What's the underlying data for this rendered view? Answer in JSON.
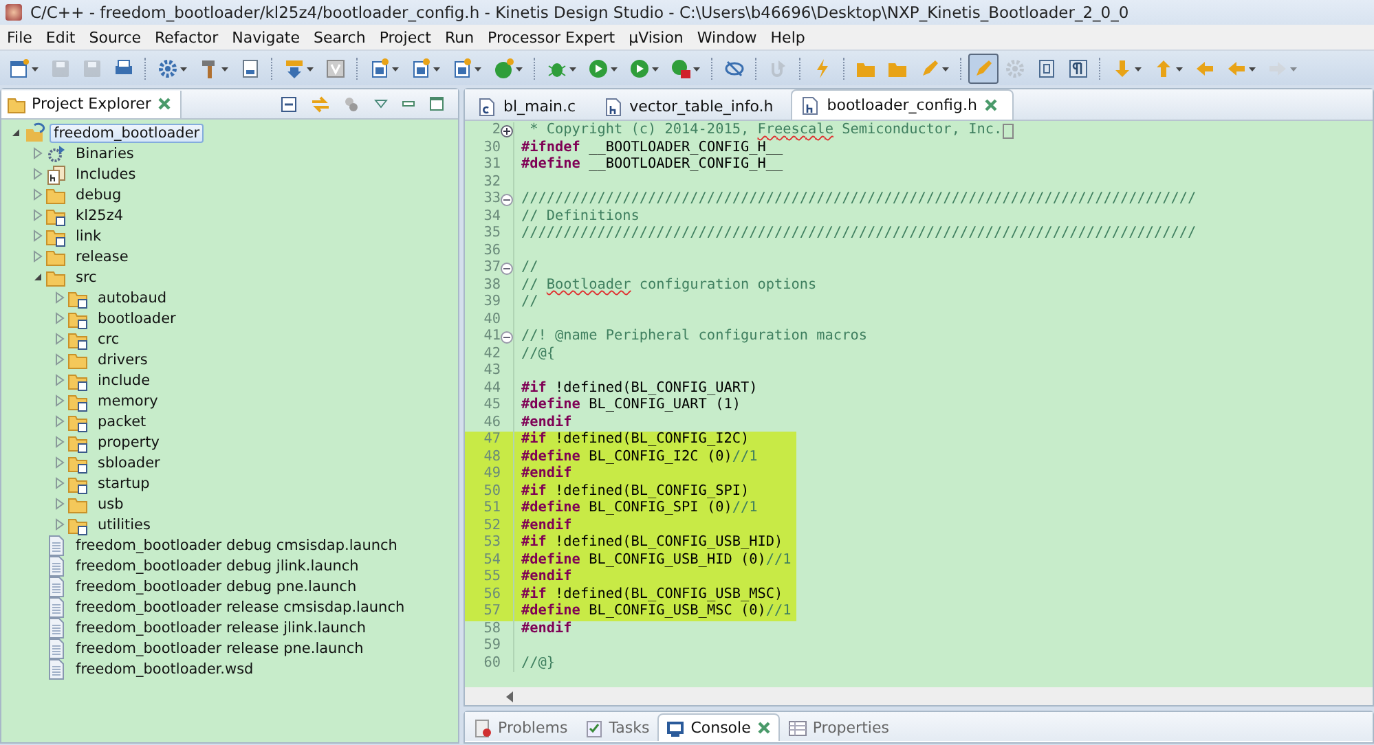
{
  "window": {
    "title": "C/C++ - freedom_bootloader/kl25z4/bootloader_config.h - Kinetis Design Studio - C:\\Users\\b46696\\Desktop\\NXP_Kinetis_Bootloader_2_0_0"
  },
  "menu": [
    "File",
    "Edit",
    "Source",
    "Refactor",
    "Navigate",
    "Search",
    "Project",
    "Run",
    "Processor Expert",
    "µVision",
    "Window",
    "Help"
  ],
  "toolbar": [
    {
      "pressed": false,
      "disabled": false
    },
    {
      "pressed": false,
      "disabled": true
    },
    {
      "pressed": false,
      "disabled": true
    },
    {
      "pressed": false,
      "disabled": false
    },
    {
      "pressed": false,
      "disabled": false
    },
    {
      "pressed": false,
      "disabled": false
    },
    {
      "pressed": false,
      "disabled": false
    },
    {
      "pressed": false,
      "disabled": false
    },
    {
      "pressed": false,
      "disabled": false
    },
    {
      "pressed": false,
      "disabled": false
    },
    {
      "pressed": false,
      "disabled": false
    },
    {
      "pressed": false,
      "disabled": false
    },
    {
      "pressed": false,
      "disabled": false
    },
    {
      "pressed": false,
      "disabled": false
    },
    {
      "pressed": false,
      "disabled": false
    },
    {
      "pressed": false,
      "disabled": false
    },
    {
      "pressed": false,
      "disabled": false
    },
    {
      "pressed": false,
      "disabled": false
    },
    {
      "pressed": false,
      "disabled": true
    },
    {
      "pressed": false,
      "disabled": false
    },
    {
      "pressed": false,
      "disabled": false
    },
    {
      "pressed": false,
      "disabled": false
    },
    {
      "pressed": false,
      "disabled": false
    },
    {
      "pressed": true,
      "disabled": false
    },
    {
      "pressed": false,
      "disabled": true
    },
    {
      "pressed": false,
      "disabled": false
    },
    {
      "pressed": false,
      "disabled": false
    },
    {
      "pressed": false,
      "disabled": false
    },
    {
      "pressed": false,
      "disabled": false
    },
    {
      "pressed": false,
      "disabled": false
    },
    {
      "pressed": false,
      "disabled": false
    },
    {
      "pressed": false,
      "disabled": true
    }
  ],
  "explorer": {
    "title": "Project Explorer",
    "tree": [
      {
        "label": "freedom_bootloader",
        "kind": "project",
        "expanded": true,
        "selected": true,
        "children": [
          {
            "label": "Binaries",
            "kind": "binaries",
            "expanded": false,
            "selected": false
          },
          {
            "label": "Includes",
            "kind": "includes",
            "expanded": false,
            "selected": false
          },
          {
            "label": "debug",
            "kind": "folder",
            "expanded": false,
            "selected": false
          },
          {
            "label": "kl25z4",
            "kind": "linked-folder",
            "expanded": false,
            "selected": false
          },
          {
            "label": "link",
            "kind": "linked-folder",
            "expanded": false,
            "selected": false
          },
          {
            "label": "release",
            "kind": "folder",
            "expanded": false,
            "selected": false
          },
          {
            "label": "src",
            "kind": "folder",
            "expanded": true,
            "selected": false,
            "children": [
              {
                "label": "autobaud",
                "kind": "linked-folder",
                "expanded": false,
                "selected": false
              },
              {
                "label": "bootloader",
                "kind": "linked-folder",
                "expanded": false,
                "selected": false
              },
              {
                "label": "crc",
                "kind": "linked-folder",
                "expanded": false,
                "selected": false
              },
              {
                "label": "drivers",
                "kind": "folder",
                "expanded": false,
                "selected": false
              },
              {
                "label": "include",
                "kind": "linked-folder",
                "expanded": false,
                "selected": false
              },
              {
                "label": "memory",
                "kind": "linked-folder",
                "expanded": false,
                "selected": false
              },
              {
                "label": "packet",
                "kind": "linked-folder",
                "expanded": false,
                "selected": false
              },
              {
                "label": "property",
                "kind": "linked-folder",
                "expanded": false,
                "selected": false
              },
              {
                "label": "sbloader",
                "kind": "linked-folder",
                "expanded": false,
                "selected": false
              },
              {
                "label": "startup",
                "kind": "linked-folder",
                "expanded": false,
                "selected": false
              },
              {
                "label": "usb",
                "kind": "folder",
                "expanded": false,
                "selected": false
              },
              {
                "label": "utilities",
                "kind": "linked-folder",
                "expanded": false,
                "selected": false
              }
            ]
          },
          {
            "label": "freedom_bootloader debug cmsisdap.launch",
            "kind": "file",
            "selected": false
          },
          {
            "label": "freedom_bootloader debug jlink.launch",
            "kind": "file",
            "selected": false
          },
          {
            "label": "freedom_bootloader debug pne.launch",
            "kind": "file",
            "selected": false
          },
          {
            "label": "freedom_bootloader release cmsisdap.launch",
            "kind": "file",
            "selected": false
          },
          {
            "label": "freedom_bootloader release jlink.launch",
            "kind": "file",
            "selected": false
          },
          {
            "label": "freedom_bootloader release pne.launch",
            "kind": "file",
            "selected": false
          },
          {
            "label": "freedom_bootloader.wsd",
            "kind": "file",
            "selected": false
          }
        ]
      }
    ]
  },
  "editor": {
    "tabs": [
      {
        "label": "bl_main.c",
        "kind": "c",
        "selected": false
      },
      {
        "label": "vector_table_info.h",
        "kind": "h",
        "selected": false
      },
      {
        "label": "bootloader_config.h",
        "kind": "h",
        "selected": true
      }
    ],
    "lines": [
      {
        "num": "2",
        "folded": true,
        "highlighted": false,
        "tokens": [
          {
            "kind": "comment",
            "text": " * Copyright (c) 2014-2015, "
          },
          {
            "kind": "comment-misspelled",
            "text": "Freescale"
          },
          {
            "kind": "comment",
            "text": " Semiconductor, Inc."
          }
        ]
      },
      {
        "num": "30",
        "highlighted": false,
        "tokens": [
          {
            "kind": "keyword",
            "text": "#ifndef"
          },
          {
            "kind": "plain",
            "text": " __BOOTLOADER_CONFIG_H__"
          }
        ]
      },
      {
        "num": "31",
        "highlighted": false,
        "tokens": [
          {
            "kind": "keyword",
            "text": "#define"
          },
          {
            "kind": "plain",
            "text": " __BOOTLOADER_CONFIG_H__"
          }
        ]
      },
      {
        "num": "32",
        "highlighted": false
      },
      {
        "num": "33",
        "folded": false,
        "highlighted": false,
        "tokens": [
          {
            "kind": "comment",
            "text": "////////////////////////////////////////////////////////////////////////////////"
          }
        ]
      },
      {
        "num": "34",
        "highlighted": false,
        "tokens": [
          {
            "kind": "comment",
            "text": "// Definitions"
          }
        ]
      },
      {
        "num": "35",
        "highlighted": false,
        "tokens": [
          {
            "kind": "comment",
            "text": "////////////////////////////////////////////////////////////////////////////////"
          }
        ]
      },
      {
        "num": "36",
        "highlighted": false
      },
      {
        "num": "37",
        "folded": false,
        "highlighted": false,
        "tokens": [
          {
            "kind": "comment",
            "text": "//"
          }
        ]
      },
      {
        "num": "38",
        "highlighted": false,
        "tokens": [
          {
            "kind": "comment",
            "text": "// "
          },
          {
            "kind": "comment-misspelled",
            "text": "Bootloader"
          },
          {
            "kind": "comment",
            "text": " configuration options"
          }
        ]
      },
      {
        "num": "39",
        "highlighted": false,
        "tokens": [
          {
            "kind": "comment",
            "text": "//"
          }
        ]
      },
      {
        "num": "40",
        "highlighted": false
      },
      {
        "num": "41",
        "folded": false,
        "highlighted": false,
        "tokens": [
          {
            "kind": "comment",
            "text": "//! @name Peripheral configuration macros"
          }
        ]
      },
      {
        "num": "42",
        "highlighted": false,
        "tokens": [
          {
            "kind": "comment",
            "text": "//@{"
          }
        ]
      },
      {
        "num": "43",
        "highlighted": false
      },
      {
        "num": "44",
        "highlighted": false,
        "tokens": [
          {
            "kind": "keyword",
            "text": "#if"
          },
          {
            "kind": "plain",
            "text": " !defined(BL_CONFIG_UART)"
          }
        ]
      },
      {
        "num": "45",
        "highlighted": false,
        "tokens": [
          {
            "kind": "keyword",
            "text": "#define"
          },
          {
            "kind": "plain",
            "text": " BL_CONFIG_UART (1)"
          }
        ]
      },
      {
        "num": "46",
        "highlighted": false,
        "tokens": [
          {
            "kind": "keyword",
            "text": "#endif"
          }
        ]
      },
      {
        "num": "47",
        "highlighted": true,
        "tokens": [
          {
            "kind": "keyword",
            "text": "#if"
          },
          {
            "kind": "plain",
            "text": " !defined(BL_CONFIG_I2C)"
          }
        ]
      },
      {
        "num": "48",
        "highlighted": true,
        "tokens": [
          {
            "kind": "keyword",
            "text": "#define"
          },
          {
            "kind": "plain",
            "text": " BL_CONFIG_I2C (0)"
          },
          {
            "kind": "comment",
            "text": "//1"
          }
        ]
      },
      {
        "num": "49",
        "highlighted": true,
        "tokens": [
          {
            "kind": "keyword",
            "text": "#endif"
          }
        ]
      },
      {
        "num": "50",
        "highlighted": true,
        "tokens": [
          {
            "kind": "keyword",
            "text": "#if"
          },
          {
            "kind": "plain",
            "text": " !defined(BL_CONFIG_SPI)"
          }
        ]
      },
      {
        "num": "51",
        "highlighted": true,
        "tokens": [
          {
            "kind": "keyword",
            "text": "#define"
          },
          {
            "kind": "plain",
            "text": " BL_CONFIG_SPI (0)"
          },
          {
            "kind": "comment",
            "text": "//1"
          }
        ]
      },
      {
        "num": "52",
        "highlighted": true,
        "tokens": [
          {
            "kind": "keyword",
            "text": "#endif"
          }
        ]
      },
      {
        "num": "53",
        "highlighted": true,
        "tokens": [
          {
            "kind": "keyword",
            "text": "#if"
          },
          {
            "kind": "plain",
            "text": " !defined(BL_CONFIG_USB_HID)"
          }
        ]
      },
      {
        "num": "54",
        "highlighted": true,
        "tokens": [
          {
            "kind": "keyword",
            "text": "#define"
          },
          {
            "kind": "plain",
            "text": " BL_CONFIG_USB_HID (0)"
          },
          {
            "kind": "comment",
            "text": "//1"
          }
        ]
      },
      {
        "num": "55",
        "highlighted": true,
        "tokens": [
          {
            "kind": "keyword",
            "text": "#endif"
          }
        ]
      },
      {
        "num": "56",
        "highlighted": true,
        "tokens": [
          {
            "kind": "keyword",
            "text": "#if"
          },
          {
            "kind": "plain",
            "text": " !defined(BL_CONFIG_USB_MSC)"
          }
        ]
      },
      {
        "num": "57",
        "highlighted": true,
        "tokens": [
          {
            "kind": "keyword",
            "text": "#define"
          },
          {
            "kind": "plain",
            "text": " BL_CONFIG_USB_MSC (0)"
          },
          {
            "kind": "comment",
            "text": "//1"
          }
        ]
      },
      {
        "num": "58",
        "highlighted": false,
        "tokens": [
          {
            "kind": "keyword",
            "text": "#endif"
          }
        ]
      },
      {
        "num": "59",
        "highlighted": false
      },
      {
        "num": "60",
        "highlighted": false,
        "tokens": [
          {
            "kind": "comment",
            "text": "//@}"
          }
        ]
      }
    ]
  },
  "bottom_panel": {
    "tabs": [
      {
        "label": "Problems",
        "kind": "problems",
        "selected": false
      },
      {
        "label": "Tasks",
        "kind": "tasks",
        "selected": false
      },
      {
        "label": "Console",
        "kind": "console",
        "selected": true
      },
      {
        "label": "Properties",
        "kind": "properties",
        "selected": false
      }
    ]
  }
}
